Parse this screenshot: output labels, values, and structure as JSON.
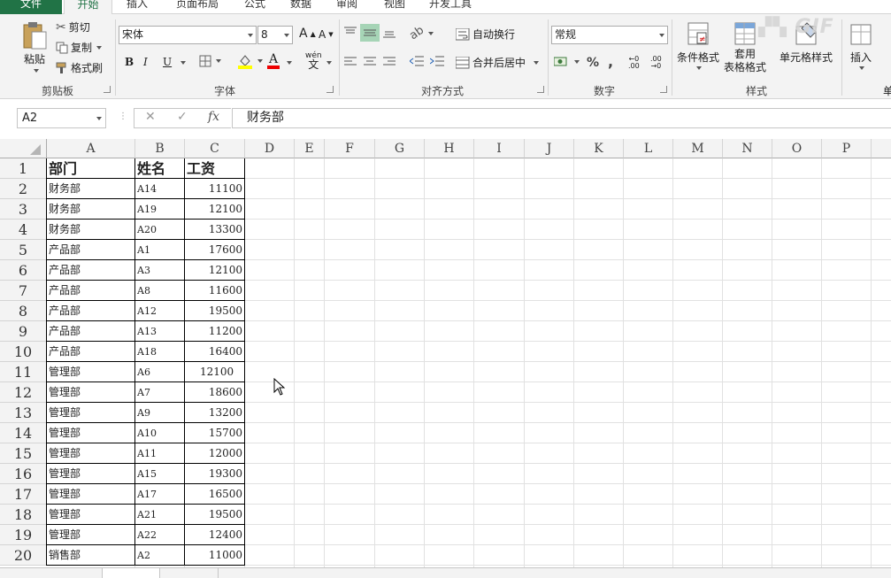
{
  "tabs": {
    "file": "文件",
    "items": [
      {
        "label": "开始",
        "active": true
      },
      {
        "label": "插入",
        "active": false
      },
      {
        "label": "页面布局",
        "active": false
      },
      {
        "label": "公式",
        "active": false
      },
      {
        "label": "数据",
        "active": false
      },
      {
        "label": "审阅",
        "active": false
      },
      {
        "label": "视图",
        "active": false
      },
      {
        "label": "开发工具",
        "active": false
      }
    ]
  },
  "ribbon": {
    "clipboard": {
      "paste": "粘贴",
      "cut": "剪切",
      "copy": "复制",
      "format_painter": "格式刷",
      "label": "剪贴板"
    },
    "font": {
      "name": "宋体",
      "size": "8",
      "bold": "B",
      "italic": "I",
      "underline": "U",
      "wen": "wén",
      "wen_char": "文",
      "grow": "A",
      "shrink": "A",
      "font_color_letter": "A",
      "label": "字体"
    },
    "alignment": {
      "wrap": "自动换行",
      "merge": "合并后居中",
      "label": "对齐方式"
    },
    "number": {
      "format": "常规",
      "percent": "%",
      "comma": ",",
      "inc_decimal_lbl": ".00",
      "dec_decimal_lbl": ".00",
      "label": "数字"
    },
    "styles": {
      "conditional": "条件格式",
      "table_format_1": "套用",
      "table_format_2": "表格格式",
      "cell_styles": "单元格样式",
      "label": "样式"
    },
    "cells": {
      "insert": "插入",
      "label_partial": "单"
    }
  },
  "formula_bar": {
    "name_box": "A2",
    "fx": "fx",
    "value": "财务部"
  },
  "columns": [
    "A",
    "B",
    "C",
    "D",
    "E",
    "F",
    "G",
    "H",
    "I",
    "J",
    "K",
    "L",
    "M",
    "N",
    "O",
    "P"
  ],
  "rows": [
    "1",
    "2",
    "3",
    "4",
    "5",
    "6",
    "7",
    "8",
    "9",
    "10",
    "11",
    "12",
    "13",
    "14",
    "15",
    "16",
    "17",
    "18",
    "19",
    "20"
  ],
  "table": {
    "headers": [
      "部门",
      "姓名",
      "工资"
    ],
    "data": [
      [
        "财务部",
        "A14",
        "11100"
      ],
      [
        "财务部",
        "A19",
        "12100"
      ],
      [
        "财务部",
        "A20",
        "13300"
      ],
      [
        "产品部",
        "A1",
        "17600"
      ],
      [
        "产品部",
        "A3",
        "12100"
      ],
      [
        "产品部",
        "A8",
        "11600"
      ],
      [
        "产品部",
        "A12",
        "19500"
      ],
      [
        "产品部",
        "A13",
        "11200"
      ],
      [
        "产品部",
        "A18",
        "16400"
      ],
      [
        "管理部",
        "A6",
        "12100"
      ],
      [
        "管理部",
        "A7",
        "18600"
      ],
      [
        "管理部",
        "A9",
        "13200"
      ],
      [
        "管理部",
        "A10",
        "15700"
      ],
      [
        "管理部",
        "A11",
        "12000"
      ],
      [
        "管理部",
        "A15",
        "19300"
      ],
      [
        "管理部",
        "A17",
        "16500"
      ],
      [
        "管理部",
        "A21",
        "19500"
      ],
      [
        "管理部",
        "A22",
        "12400"
      ],
      [
        "销售部",
        "A2",
        "11000"
      ]
    ]
  },
  "watermark": "GIF",
  "colors": {
    "accent": "#217346",
    "header_bg": "#f3f3f3",
    "gridline": "#e1e1e1"
  }
}
